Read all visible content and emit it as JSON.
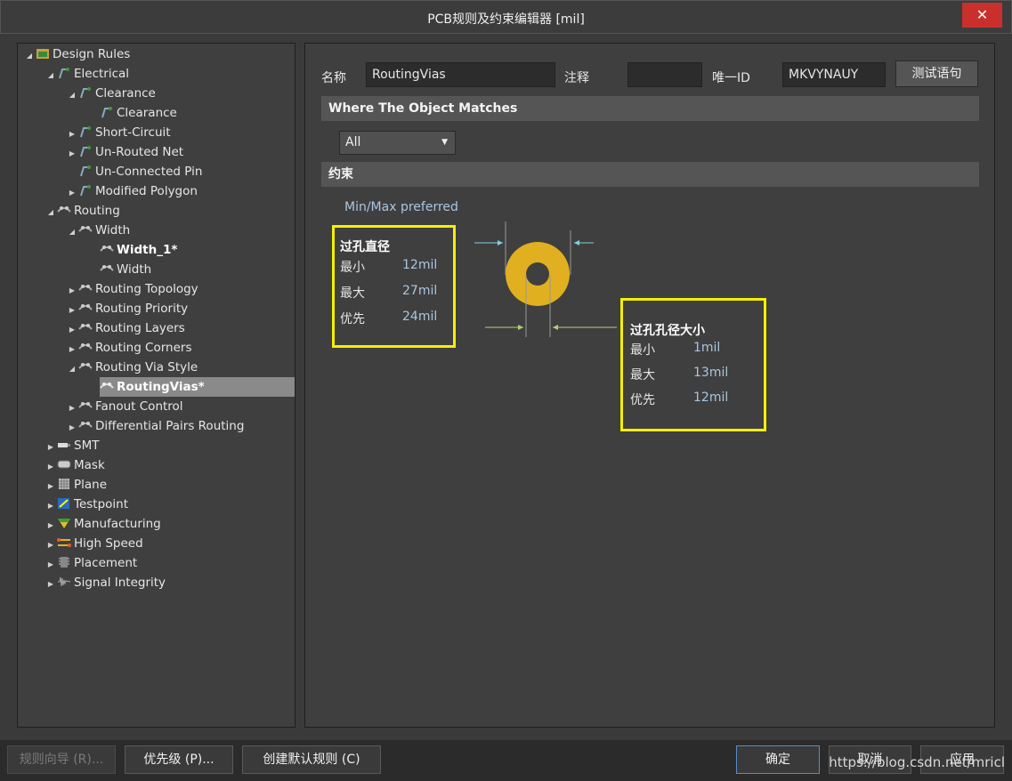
{
  "window": {
    "title": "PCB规则及约束编辑器 [mil]",
    "close_glyph": "✕"
  },
  "tree": {
    "items": [
      {
        "label": "Design Rules",
        "icon": "rules-folder-icon"
      },
      {
        "label": "Electrical",
        "icon": "electrical-icon"
      },
      {
        "label": "Clearance",
        "icon": "electrical-icon"
      },
      {
        "label": "Clearance",
        "icon": "electrical-icon"
      },
      {
        "label": "Short-Circuit",
        "icon": "electrical-icon"
      },
      {
        "label": "Un-Routed Net",
        "icon": "electrical-icon"
      },
      {
        "label": "Un-Connected Pin",
        "icon": "electrical-icon"
      },
      {
        "label": "Modified Polygon",
        "icon": "electrical-icon"
      },
      {
        "label": "Routing",
        "icon": "routing-icon"
      },
      {
        "label": "Width",
        "icon": "routing-icon"
      },
      {
        "label": "Width_1*",
        "icon": "routing-icon"
      },
      {
        "label": "Width",
        "icon": "routing-icon"
      },
      {
        "label": "Routing Topology",
        "icon": "routing-icon"
      },
      {
        "label": "Routing Priority",
        "icon": "routing-icon"
      },
      {
        "label": "Routing Layers",
        "icon": "routing-icon"
      },
      {
        "label": "Routing Corners",
        "icon": "routing-icon"
      },
      {
        "label": "Routing Via Style",
        "icon": "routing-icon"
      },
      {
        "label": "RoutingVias*",
        "icon": "routing-icon"
      },
      {
        "label": "Fanout Control",
        "icon": "routing-icon"
      },
      {
        "label": "Differential Pairs Routing",
        "icon": "routing-icon"
      },
      {
        "label": "SMT",
        "icon": "smt-icon"
      },
      {
        "label": "Mask",
        "icon": "mask-icon"
      },
      {
        "label": "Plane",
        "icon": "plane-icon"
      },
      {
        "label": "Testpoint",
        "icon": "testpoint-icon"
      },
      {
        "label": "Manufacturing",
        "icon": "manufacturing-icon"
      },
      {
        "label": "High Speed",
        "icon": "high-speed-icon"
      },
      {
        "label": "Placement",
        "icon": "placement-icon"
      },
      {
        "label": "Signal Integrity",
        "icon": "signal-integrity-icon"
      }
    ]
  },
  "form": {
    "name_label": "名称",
    "name_value": "RoutingVias",
    "comment_label": "注释",
    "comment_value": "",
    "uid_label": "唯一ID",
    "uid_value": "MKVYNAUY",
    "test_button": "测试语句"
  },
  "where_section": {
    "title": "Where The Object Matches",
    "dropdown_value": "All"
  },
  "constraint_section": {
    "title": "约束",
    "mode": "Min/Max preferred"
  },
  "via_diameter": {
    "title": "过孔直径",
    "min_label": "最小",
    "min_value": "12mil",
    "max_label": "最大",
    "max_value": "27mil",
    "pref_label": "优先",
    "pref_value": "24mil"
  },
  "hole_size": {
    "title": "过孔孔径大小",
    "min_label": "最小",
    "min_value": "1mil",
    "max_label": "最大",
    "max_value": "13mil",
    "pref_label": "优先",
    "pref_value": "12mil"
  },
  "footer": {
    "rule_wizard": "规则向导 (R)...",
    "priority": "优先级 (P)...",
    "create_default": "创建默认规则 (C)",
    "ok": "确定",
    "cancel": "取消",
    "apply": "应用",
    "watermark": "https://blog.csdn.net/mricl"
  },
  "colors": {
    "via_ring": "#e0b020",
    "highlight_box": "#f5f000",
    "dimension_line": "#7fd0e0"
  }
}
